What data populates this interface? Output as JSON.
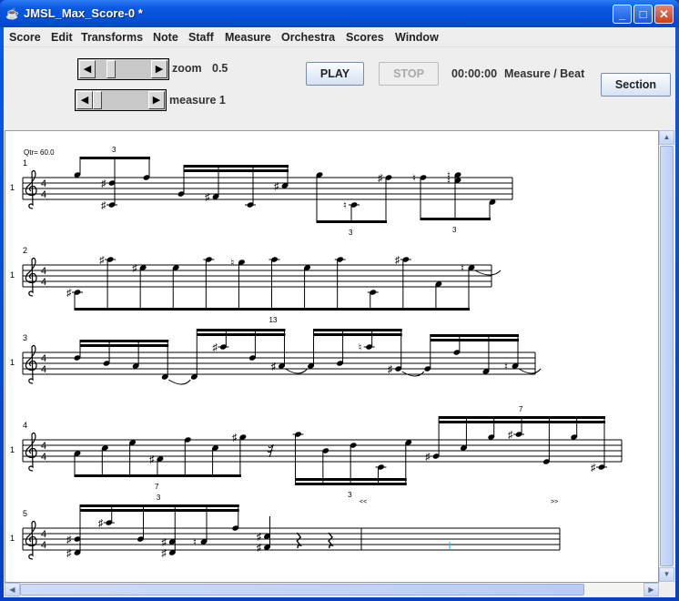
{
  "window": {
    "title": "JMSL_Max_Score-0 *"
  },
  "menu": [
    "Score",
    "Edit",
    "Transforms",
    "Note",
    "Staff",
    "Measure",
    "Orchestra",
    "Scores",
    "Window"
  ],
  "toolbar": {
    "zoom_label": "zoom",
    "zoom_value": "0.5",
    "measure_label": "measure 1",
    "play": "PLAY",
    "stop": "STOP",
    "time": "00:00:00",
    "position_label": "Measure / Beat",
    "section": "Section",
    "zoom_slider_fraction": 0.45,
    "measure_slider_fraction": 0.05
  },
  "score": {
    "tempo": "Qtr= 60.0",
    "colors": {
      "cursor": "#00c8e0"
    },
    "systems": [
      {
        "measure": "1",
        "staff_label": "1",
        "time": [
          "4",
          "4"
        ],
        "groups": [
          {
            "dir": "up",
            "beams": 1,
            "tuplet": "3",
            "notes": [
              {
                "s": [
                  9
                ]
              },
              {
                "s": [
                  6,
                  -2
                ],
                "acc": "sharp"
              },
              {
                "s": [
                  8
                ]
              }
            ]
          },
          {
            "dir": "up",
            "beams": 2,
            "notes": [
              {
                "s": [
                  2
                ]
              },
              {
                "s": [
                  1
                ],
                "acc": "sharp"
              },
              {
                "s": [
                  -2
                ]
              },
              {
                "s": [
                  5
                ],
                "acc": "sharp"
              }
            ]
          },
          {
            "dir": "down",
            "beams": 1,
            "tuplet": "3",
            "notes": [
              {
                "s": [
                  9
                ]
              },
              {
                "s": [
                  -2
                ],
                "acc": "natural"
              },
              {
                "s": [
                  8
                ],
                "acc": "sharp"
              }
            ]
          },
          {
            "dir": "down",
            "beams": 1,
            "tuplet": "3",
            "notes": [
              {
                "s": [
                  8
                ],
                "acc": "natural"
              },
              {
                "s": [
                  7,
                  9
                ],
                "acc": "natural"
              },
              {
                "s": [
                  -1
                ]
              }
            ]
          }
        ]
      },
      {
        "measure": "2",
        "staff_label": "1",
        "time": [
          "4",
          "4"
        ],
        "groups": [
          {
            "dir": "down",
            "beams": 1,
            "tuplet": "13",
            "notes": [
              {
                "s": [
                  -2
                ],
                "acc": "sharp"
              },
              {
                "s": [
                  10
                ],
                "acc": "sharp"
              },
              {
                "s": [
                  7
                ],
                "acc": "sharp"
              },
              {
                "s": [
                  7
                ]
              },
              {
                "s": [
                  10
                ]
              },
              {
                "s": [
                  9
                ],
                "acc": "natural"
              },
              {
                "s": [
                  10
                ]
              },
              {
                "s": [
                  7
                ]
              },
              {
                "s": [
                  10
                ]
              },
              {
                "s": [
                  -2
                ]
              },
              {
                "s": [
                  10
                ],
                "acc": "sharp"
              },
              {
                "s": [
                  1
                ]
              },
              {
                "s": [
                  7
                ],
                "acc": "natural",
                "tie": true
              }
            ]
          }
        ]
      },
      {
        "measure": "3",
        "staff_label": "1",
        "time": [
          "4",
          "4"
        ],
        "groups": [
          {
            "dir": "up",
            "beams": 2,
            "notes": [
              {
                "s": [
                  6
                ]
              },
              {
                "s": [
                  4
                ]
              },
              {
                "s": [
                  3
                ]
              },
              {
                "s": [
                  -1
                ],
                "tie": true
              }
            ]
          },
          {
            "dir": "up",
            "beams": 2,
            "notes": [
              {
                "s": [
                  -1
                ]
              },
              {
                "s": [
                  10
                ],
                "acc": "sharp"
              },
              {
                "s": [
                  6
                ]
              },
              {
                "s": [
                  3
                ],
                "acc": "sharp",
                "tie": true
              }
            ]
          },
          {
            "dir": "up",
            "beams": 2,
            "notes": [
              {
                "s": [
                  3
                ]
              },
              {
                "s": [
                  4
                ]
              },
              {
                "s": [
                  10
                ],
                "acc": "natural"
              },
              {
                "s": [
                  2
                ],
                "acc": "sharp",
                "tie": true
              }
            ]
          },
          {
            "dir": "up",
            "beams": 2,
            "notes": [
              {
                "s": [
                  2
                ]
              },
              {
                "s": [
                  8
                ]
              },
              {
                "s": [
                  1
                ]
              },
              {
                "s": [
                  3
                ],
                "acc": "natural",
                "tie": true
              }
            ]
          }
        ]
      },
      {
        "measure": "4",
        "staff_label": "1",
        "time": [
          "4",
          "4"
        ],
        "groups": [
          {
            "dir": "down",
            "beams": 1,
            "tuplet": "7",
            "notes": [
              {
                "s": [
                  3
                ]
              },
              {
                "s": [
                  5
                ]
              },
              {
                "s": [
                  7
                ]
              },
              {
                "s": [
                  1
                ],
                "acc": "sharp"
              },
              {
                "s": [
                  8
                ]
              },
              {
                "s": [
                  5
                ]
              },
              {
                "s": [
                  9
                ],
                "acc": "sharp"
              }
            ]
          },
          {
            "rest": "sixteenth"
          },
          {
            "dir": "down",
            "beams": 2,
            "tuplet": "3",
            "notes": [
              {
                "s": [
                  10
                ]
              },
              {
                "s": [
                  4
                ]
              },
              {
                "s": [
                  6
                ]
              },
              {
                "s": [
                  -2
                ]
              },
              {
                "s": [
                  7
                ]
              }
            ]
          },
          {
            "dir": "up",
            "beams": 2,
            "tuplet": "7",
            "notes": [
              {
                "s": [
                  2
                ],
                "acc": "sharp"
              },
              {
                "s": [
                  5
                ]
              },
              {
                "s": [
                  9
                ]
              },
              {
                "s": [
                  10
                ],
                "acc": "sharp"
              },
              {
                "s": [
                  0
                ]
              },
              {
                "s": [
                  9
                ]
              },
              {
                "s": [
                  -2
                ],
                "acc": "sharp"
              }
            ]
          }
        ],
        "markers": [
          "<<",
          ">>"
        ]
      },
      {
        "measure": "5",
        "staff_label": "1",
        "time": [
          "4",
          "4"
        ],
        "groups": [
          {
            "dir": "up",
            "beams": 2,
            "tuplet": "3",
            "notes": [
              {
                "s": [
                  4,
                  -1
                ],
                "acc": "sharp"
              },
              {
                "s": [
                  10
                ],
                "acc": "sharp"
              },
              {
                "s": [
                  4
                ]
              },
              {
                "s": [
                  3,
                  -1
                ],
                "acc": "sharp"
              },
              {
                "s": [
                  3
                ],
                "acc": "natural"
              },
              {
                "s": [
                  8
                ]
              }
            ]
          },
          {
            "dir": "up",
            "beams": 0,
            "notes": [
              {
                "s": [
                  1,
                  5
                ],
                "acc": "sharp"
              }
            ]
          },
          {
            "rest": "quarter"
          },
          {
            "rest": "quarter"
          }
        ]
      }
    ]
  }
}
